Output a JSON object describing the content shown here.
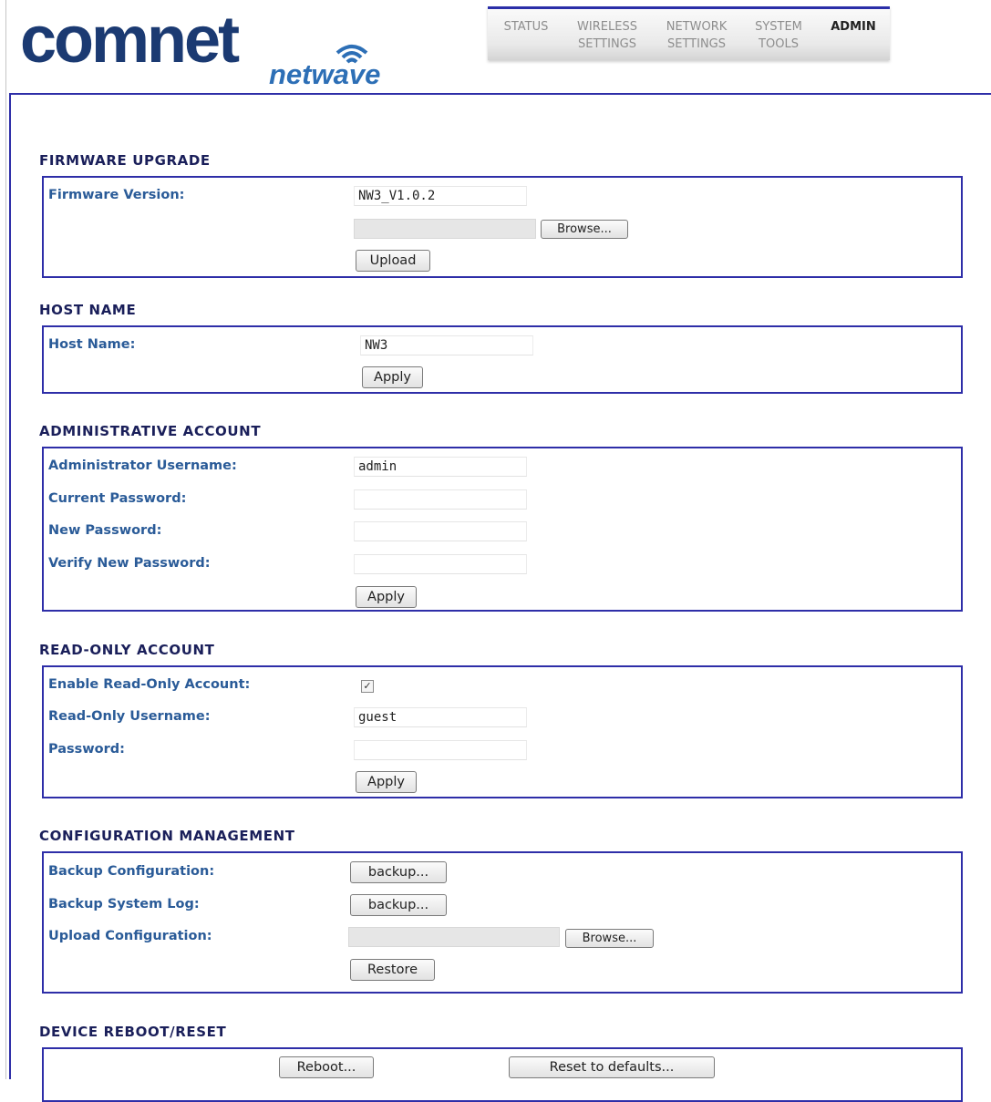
{
  "brand": {
    "logo": "comnet",
    "sub": "netwave"
  },
  "nav": {
    "items": [
      {
        "line1": "STATUS",
        "line2": ""
      },
      {
        "line1": "WIRELESS",
        "line2": "SETTINGS"
      },
      {
        "line1": "NETWORK",
        "line2": "SETTINGS"
      },
      {
        "line1": "SYSTEM",
        "line2": "TOOLS"
      },
      {
        "line1": "ADMIN",
        "line2": ""
      }
    ],
    "active": "ADMIN"
  },
  "firmware": {
    "title": "FIRMWARE UPGRADE",
    "version_label": "Firmware Version:",
    "version_value": "NW3_V1.0.2",
    "browse_label": "Browse...",
    "upload_label": "Upload"
  },
  "host": {
    "title": "HOST NAME",
    "label": "Host Name:",
    "value": "NW3",
    "apply_label": "Apply"
  },
  "admin": {
    "title": "ADMINISTRATIVE ACCOUNT",
    "username_label": "Administrator Username:",
    "username_value": "admin",
    "current_label": "Current Password:",
    "new_label": "New Password:",
    "verify_label": "Verify New Password:",
    "apply_label": "Apply"
  },
  "readonly": {
    "title": "READ-ONLY ACCOUNT",
    "enable_label": "Enable Read-Only Account:",
    "enable_checked": true,
    "username_label": "Read-Only Username:",
    "username_value": "guest",
    "password_label": "Password:",
    "apply_label": "Apply"
  },
  "config": {
    "title": "CONFIGURATION MANAGEMENT",
    "backup_config_label": "Backup Configuration:",
    "backup_log_label": "Backup System Log:",
    "upload_label": "Upload Configuration:",
    "backup_button": "backup...",
    "browse_label": "Browse...",
    "restore_label": "Restore"
  },
  "reboot": {
    "title": "DEVICE REBOOT/RESET",
    "reboot_label": "Reboot...",
    "reset_label": "Reset to defaults..."
  },
  "colors": {
    "accent": "#2e2ea8",
    "label": "#2a5b98",
    "title": "#1a1f5a",
    "logo": "#1b3a72"
  }
}
